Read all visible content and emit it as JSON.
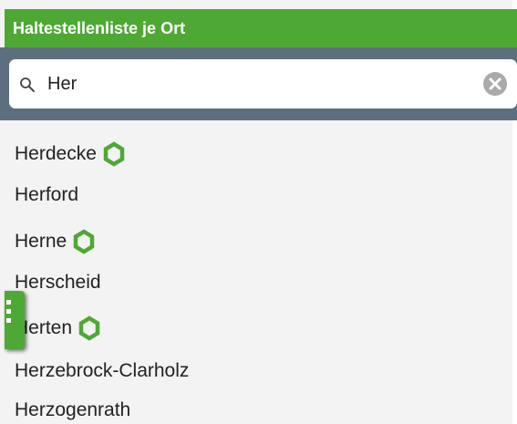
{
  "header": {
    "title": "Haltestellenliste je Ort"
  },
  "search": {
    "value": "Her",
    "placeholder": ""
  },
  "colors": {
    "accent": "#4ea834",
    "search_bar_bg": "#5d6e7f",
    "hub_icon": "#4ea834"
  },
  "results": [
    {
      "label": "Herdecke",
      "hub_icon": true
    },
    {
      "label": "Herford",
      "hub_icon": false
    },
    {
      "label": "Herne",
      "hub_icon": true
    },
    {
      "label": "Herscheid",
      "hub_icon": false
    },
    {
      "label": "Herten",
      "hub_icon": true
    },
    {
      "label": "Herzebrock-Clarholz",
      "hub_icon": false
    },
    {
      "label": "Herzogenrath",
      "hub_icon": false
    }
  ],
  "icons": {
    "search": "search-icon",
    "clear": "clear-icon",
    "hub": "hexagon-stop-icon",
    "drawer": "drawer-handle-icon"
  }
}
